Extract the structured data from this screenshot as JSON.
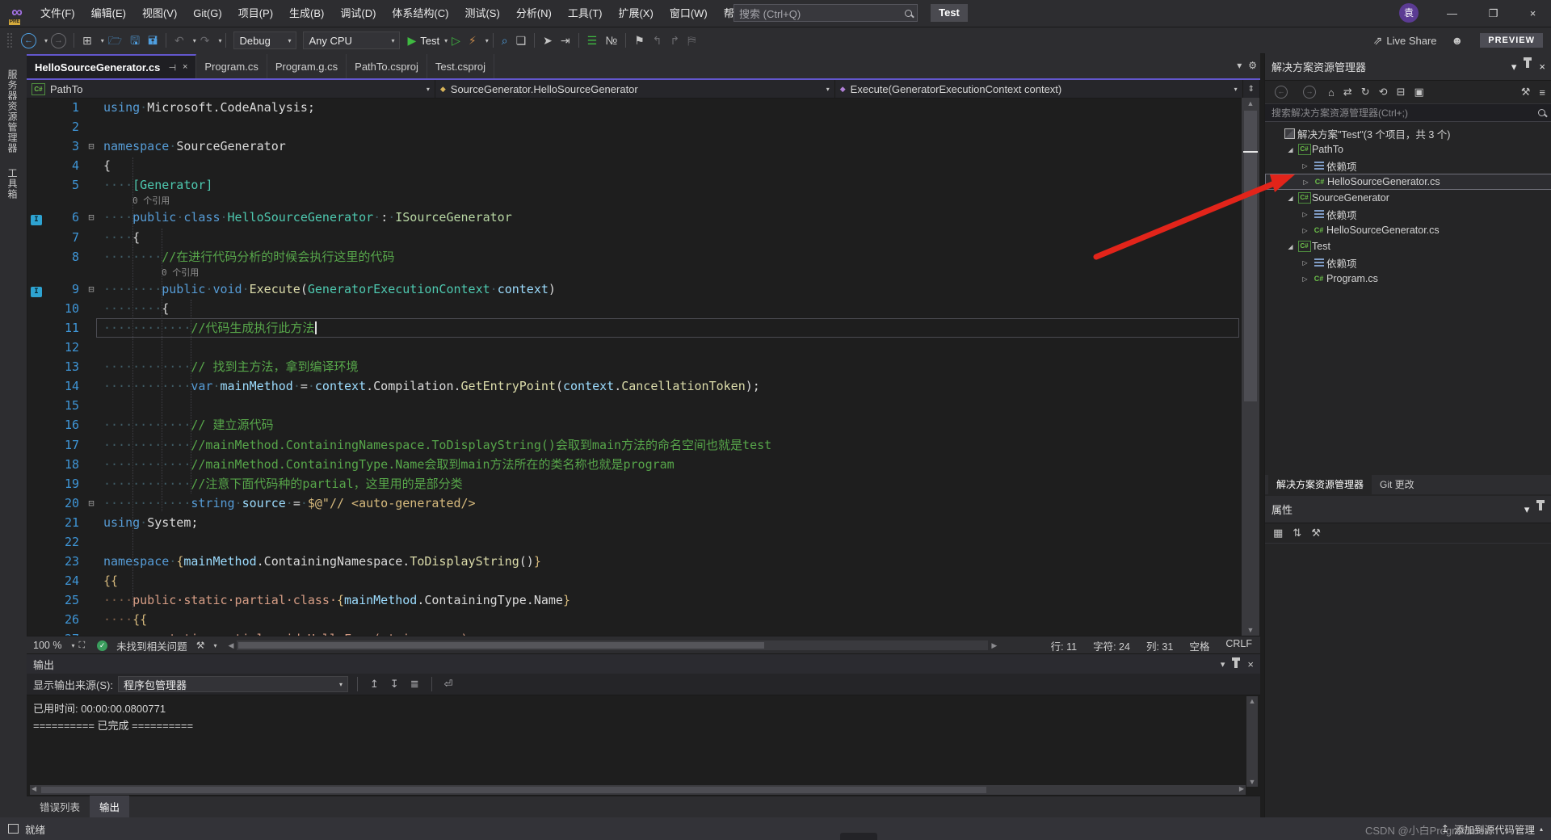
{
  "colors": {
    "accent": "#6357CE",
    "arrow_red": "#E2241A",
    "comment_green": "#57A64A",
    "keyword_blue": "#569CD6",
    "type_teal": "#4EC9B0",
    "method_yellow": "#DCDCAA",
    "string_tan": "#D69D85",
    "local_blue": "#9CDCFE"
  },
  "title_bar": {
    "menus": [
      "文件(F)",
      "编辑(E)",
      "视图(V)",
      "Git(G)",
      "项目(P)",
      "生成(B)",
      "调试(D)",
      "体系结构(C)",
      "测试(S)",
      "分析(N)",
      "工具(T)",
      "扩展(X)",
      "窗口(W)",
      "帮助(H)"
    ],
    "search_placeholder": "搜索 (Ctrl+Q)",
    "context_label": "Test",
    "avatar_initial": "袁"
  },
  "toolbar": {
    "config": "Debug",
    "platform": "Any CPU",
    "run_target": "Test",
    "live_share": "Live Share",
    "preview_badge": "PREVIEW"
  },
  "left_strip": {
    "items": [
      "服务器资源管理器",
      "工具箱"
    ]
  },
  "editor": {
    "tabs": [
      {
        "label": "HelloSourceGenerator.cs",
        "active": true
      },
      {
        "label": "Program.cs",
        "active": false
      },
      {
        "label": "Program.g.cs",
        "active": false
      },
      {
        "label": "PathTo.csproj",
        "active": false
      },
      {
        "label": "Test.csproj",
        "active": false
      }
    ],
    "breadcrumb": {
      "project": "PathTo",
      "type": "SourceGenerator.HelloSourceGenerator",
      "member": "Execute(GeneratorExecutionContext context)"
    },
    "rows": [
      {
        "n": 1,
        "seg": [
          [
            "k",
            "using"
          ],
          [
            "w",
            "·"
          ],
          [
            "p",
            "Microsoft.CodeAnalysis;"
          ]
        ]
      },
      {
        "n": 2,
        "seg": []
      },
      {
        "n": 3,
        "f": 1,
        "seg": [
          [
            "k",
            "namespace"
          ],
          [
            "w",
            "·"
          ],
          [
            "p",
            "SourceGenerator"
          ]
        ]
      },
      {
        "n": 4,
        "seg": [
          [
            "p",
            "{"
          ]
        ]
      },
      {
        "n": 5,
        "seg": [
          [
            "w",
            "····"
          ],
          [
            "t",
            "[Generator]"
          ]
        ]
      },
      {
        "lens": "0 个引用",
        "ind": 131
      },
      {
        "n": 6,
        "f": 1,
        "g": 1,
        "seg": [
          [
            "w",
            "····"
          ],
          [
            "k",
            "public"
          ],
          [
            "w",
            "·"
          ],
          [
            "k",
            "class"
          ],
          [
            "w",
            "·"
          ],
          [
            "t",
            "HelloSourceGenerator"
          ],
          [
            "w",
            "·"
          ],
          [
            "p",
            ":"
          ],
          [
            "w",
            "·"
          ],
          [
            "i",
            "ISourceGenerator"
          ]
        ]
      },
      {
        "n": 7,
        "seg": [
          [
            "w",
            "····"
          ],
          [
            "p",
            "{"
          ]
        ]
      },
      {
        "n": 8,
        "seg": [
          [
            "w",
            "········"
          ],
          [
            "c",
            "//在进行代码分析的时候会执行这里的代码"
          ]
        ]
      },
      {
        "lens": "0 个引用",
        "ind": 167
      },
      {
        "n": 9,
        "f": 1,
        "g": 1,
        "seg": [
          [
            "w",
            "········"
          ],
          [
            "k",
            "public"
          ],
          [
            "w",
            "·"
          ],
          [
            "k",
            "void"
          ],
          [
            "w",
            "·"
          ],
          [
            "m",
            "Execute"
          ],
          [
            "p",
            "("
          ],
          [
            "t",
            "GeneratorExecutionContext"
          ],
          [
            "w",
            "·"
          ],
          [
            "l",
            "context"
          ],
          [
            "p",
            ")"
          ]
        ]
      },
      {
        "n": 10,
        "seg": [
          [
            "w",
            "········"
          ],
          [
            "p",
            "{"
          ]
        ]
      },
      {
        "n": 11,
        "cur": 1,
        "seg": [
          [
            "w",
            "············"
          ],
          [
            "c",
            "//代码生成执行此方法"
          ]
        ]
      },
      {
        "n": 12,
        "seg": []
      },
      {
        "n": 13,
        "seg": [
          [
            "w",
            "············"
          ],
          [
            "c",
            "// 找到主方法，拿到编译环境"
          ]
        ]
      },
      {
        "n": 14,
        "seg": [
          [
            "w",
            "············"
          ],
          [
            "k",
            "var"
          ],
          [
            "w",
            "·"
          ],
          [
            "l",
            "mainMethod"
          ],
          [
            "w",
            "·"
          ],
          [
            "p",
            "="
          ],
          [
            "w",
            "·"
          ],
          [
            "l",
            "context"
          ],
          [
            "p",
            ".Compilation."
          ],
          [
            "m",
            "GetEntryPoint"
          ],
          [
            "p",
            "("
          ],
          [
            "l",
            "context"
          ],
          [
            "p",
            "."
          ],
          [
            "m",
            "CancellationToken"
          ],
          [
            "p",
            ");"
          ]
        ]
      },
      {
        "n": 15,
        "seg": []
      },
      {
        "n": 16,
        "seg": [
          [
            "w",
            "············"
          ],
          [
            "c",
            "// 建立源代码"
          ]
        ]
      },
      {
        "n": 17,
        "seg": [
          [
            "w",
            "············"
          ],
          [
            "c",
            "//mainMethod.ContainingNamespace.ToDisplayString()会取到main方法的命名空间也就是test"
          ]
        ]
      },
      {
        "n": 18,
        "seg": [
          [
            "w",
            "············"
          ],
          [
            "c",
            "//mainMethod.ContainingType.Name会取到main方法所在的类名称也就是program"
          ]
        ]
      },
      {
        "n": 19,
        "seg": [
          [
            "w",
            "············"
          ],
          [
            "c",
            "//注意下面代码种的partial，这里用的是部分类"
          ]
        ]
      },
      {
        "n": 20,
        "f": 1,
        "seg": [
          [
            "w",
            "············"
          ],
          [
            "k",
            "string"
          ],
          [
            "w",
            "·"
          ],
          [
            "l",
            "source"
          ],
          [
            "w",
            "·"
          ],
          [
            "p",
            "="
          ],
          [
            "w",
            "·"
          ],
          [
            "b",
            "$@\"// <auto-generated/>"
          ]
        ]
      },
      {
        "n": 21,
        "seg": [
          [
            "k",
            "using"
          ],
          [
            "w",
            "·"
          ],
          [
            "p",
            "System;"
          ]
        ]
      },
      {
        "n": 22,
        "seg": []
      },
      {
        "n": 23,
        "seg": [
          [
            "k",
            "namespace"
          ],
          [
            "w",
            "·"
          ],
          [
            "b",
            "{"
          ],
          [
            "l",
            "mainMethod"
          ],
          [
            "p",
            ".ContainingNamespace."
          ],
          [
            "m",
            "ToDisplayString"
          ],
          [
            "p",
            "()"
          ],
          [
            "b",
            "}"
          ]
        ]
      },
      {
        "n": 24,
        "seg": [
          [
            "b",
            "{{"
          ]
        ]
      },
      {
        "n": 25,
        "seg": [
          [
            "v",
            "····"
          ],
          [
            "s",
            "public·static·partial·class·"
          ],
          [
            "b",
            "{"
          ],
          [
            "l",
            "mainMethod"
          ],
          [
            "p",
            ".ContainingType.Name"
          ],
          [
            "b",
            "}"
          ]
        ]
      },
      {
        "n": 26,
        "seg": [
          [
            "v",
            "····"
          ],
          [
            "b",
            "{{"
          ]
        ]
      },
      {
        "n": 27,
        "seg": [
          [
            "v",
            "········"
          ],
          [
            "s",
            "static·partial·void·HelloFrom(string·name)·=>"
          ]
        ]
      }
    ],
    "status": {
      "zoom": "100 %",
      "health": "未找到相关问题",
      "line": "行: 11",
      "char": "字符: 24",
      "col": "列: 31",
      "spaces": "空格",
      "eol": "CRLF"
    }
  },
  "output": {
    "title": "输出",
    "source_label": "显示输出来源(S):",
    "source": "程序包管理器",
    "lines": [
      "已用时间: 00:00:00.0800771",
      "========== 已完成 =========="
    ]
  },
  "window_tabs": [
    {
      "label": "错误列表",
      "active": false
    },
    {
      "label": "输出",
      "active": true
    }
  ],
  "status_bar": {
    "ready": "就绪",
    "source_control": "添加到源代码管理",
    "watermark": "CSDN @小白Programmer"
  },
  "solution_explorer": {
    "title": "解决方案资源管理器",
    "search_placeholder": "搜索解决方案资源管理器(Ctrl+;)",
    "tree": [
      {
        "lvl": 0,
        "arrow": "",
        "icon": "sln",
        "label": "解决方案\"Test\"(3 个项目，共 3 个)"
      },
      {
        "lvl": 1,
        "arrow": "exp",
        "icon": "proj",
        "label": "PathTo"
      },
      {
        "lvl": 2,
        "arrow": "col",
        "icon": "dep",
        "label": "依赖项"
      },
      {
        "lvl": 2,
        "arrow": "col",
        "icon": "cs",
        "label": "HelloSourceGenerator.cs",
        "selected": true
      },
      {
        "lvl": 1,
        "arrow": "exp",
        "icon": "proj",
        "label": "SourceGenerator"
      },
      {
        "lvl": 2,
        "arrow": "col",
        "icon": "dep",
        "label": "依赖项"
      },
      {
        "lvl": 2,
        "arrow": "col",
        "icon": "cs",
        "label": "HelloSourceGenerator.cs"
      },
      {
        "lvl": 1,
        "arrow": "exp",
        "icon": "proj",
        "label": "Test"
      },
      {
        "lvl": 2,
        "arrow": "col",
        "icon": "dep",
        "label": "依赖项"
      },
      {
        "lvl": 2,
        "arrow": "col",
        "icon": "cs",
        "label": "Program.cs"
      }
    ],
    "panel_tabs": [
      {
        "label": "解决方案资源管理器",
        "active": true
      },
      {
        "label": "Git 更改",
        "active": false
      }
    ]
  },
  "properties": {
    "title": "属性"
  }
}
